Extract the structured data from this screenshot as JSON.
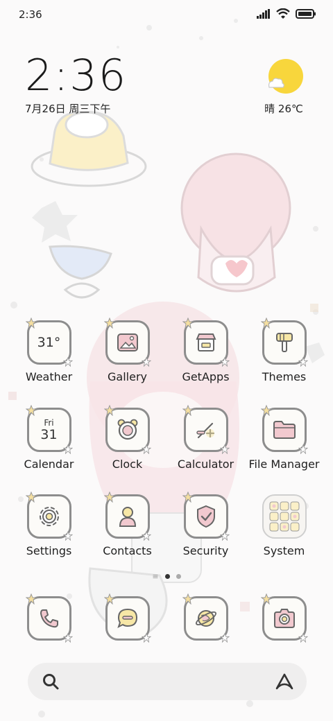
{
  "status_bar": {
    "time": "2:36"
  },
  "clock_widget": {
    "time": "2:36",
    "date": "7月26日 周三下午"
  },
  "weather_widget": {
    "condition": "晴",
    "temperature": "26℃",
    "text": "晴 26℃",
    "sun_color": "#f8d63c"
  },
  "apps": [
    {
      "label": "Weather",
      "icon": "weather-icon",
      "glyph": "31°"
    },
    {
      "label": "Gallery",
      "icon": "gallery-icon"
    },
    {
      "label": "GetApps",
      "icon": "getapps-icon"
    },
    {
      "label": "Themes",
      "icon": "themes-icon"
    },
    {
      "label": "Calendar",
      "icon": "calendar-icon",
      "day_name": "Fri",
      "day_number": "31"
    },
    {
      "label": "Clock",
      "icon": "clock-icon"
    },
    {
      "label": "Calculator",
      "icon": "calculator-icon"
    },
    {
      "label": "File Manager",
      "icon": "folder-icon"
    },
    {
      "label": "Settings",
      "icon": "gear-icon"
    },
    {
      "label": "Contacts",
      "icon": "contacts-icon"
    },
    {
      "label": "Security",
      "icon": "shield-icon"
    },
    {
      "label": "System",
      "icon": "app-folder-icon"
    }
  ],
  "dock": [
    {
      "icon": "phone-icon"
    },
    {
      "icon": "messages-icon"
    },
    {
      "icon": "browser-icon"
    },
    {
      "icon": "camera-icon"
    }
  ],
  "page_indicator": {
    "pages": 2,
    "active": 1
  },
  "search_bar": {
    "left_icon": "search-icon",
    "right_icon": "assistant-icon"
  },
  "theme_colors": {
    "outline": "#8d8d8d",
    "pink": "#f2c9cf",
    "yellow": "#f7e7a6",
    "star": "#f5dfa0"
  }
}
